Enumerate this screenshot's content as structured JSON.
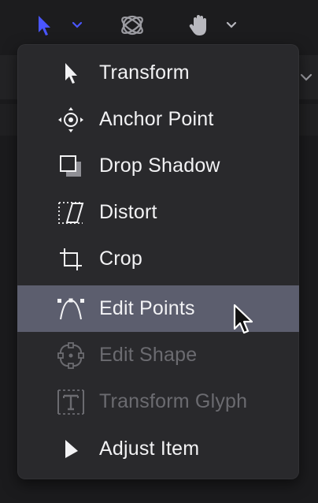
{
  "toolbar": {
    "select_tool": "arrow-cursor-icon",
    "select_dropdown": "chevron-down-icon",
    "orbit_tool": "orbit-icon",
    "pan_tool": "hand-icon",
    "pan_dropdown": "chevron-down-icon"
  },
  "colors": {
    "accent": "#4a56ff",
    "menu_bg": "#29292c",
    "highlight": "#5c5e6e",
    "text": "#f2f2f4",
    "disabled_text": "#6b6b70"
  },
  "menu": {
    "items": [
      {
        "label": "Transform",
        "icon": "arrow-pointer-icon",
        "state": "enabled"
      },
      {
        "label": "Anchor Point",
        "icon": "anchor-point-icon",
        "state": "enabled"
      },
      {
        "label": "Drop Shadow",
        "icon": "drop-shadow-icon",
        "state": "enabled"
      },
      {
        "label": "Distort",
        "icon": "distort-icon",
        "state": "enabled"
      },
      {
        "label": "Crop",
        "icon": "crop-icon",
        "state": "enabled"
      },
      {
        "label": "Edit Points",
        "icon": "edit-points-icon",
        "state": "highlighted"
      },
      {
        "label": "Edit Shape",
        "icon": "edit-shape-icon",
        "state": "disabled"
      },
      {
        "label": "Transform Glyph",
        "icon": "transform-glyph-icon",
        "state": "disabled"
      },
      {
        "label": "Adjust Item",
        "icon": "adjust-item-icon",
        "state": "enabled"
      }
    ]
  }
}
